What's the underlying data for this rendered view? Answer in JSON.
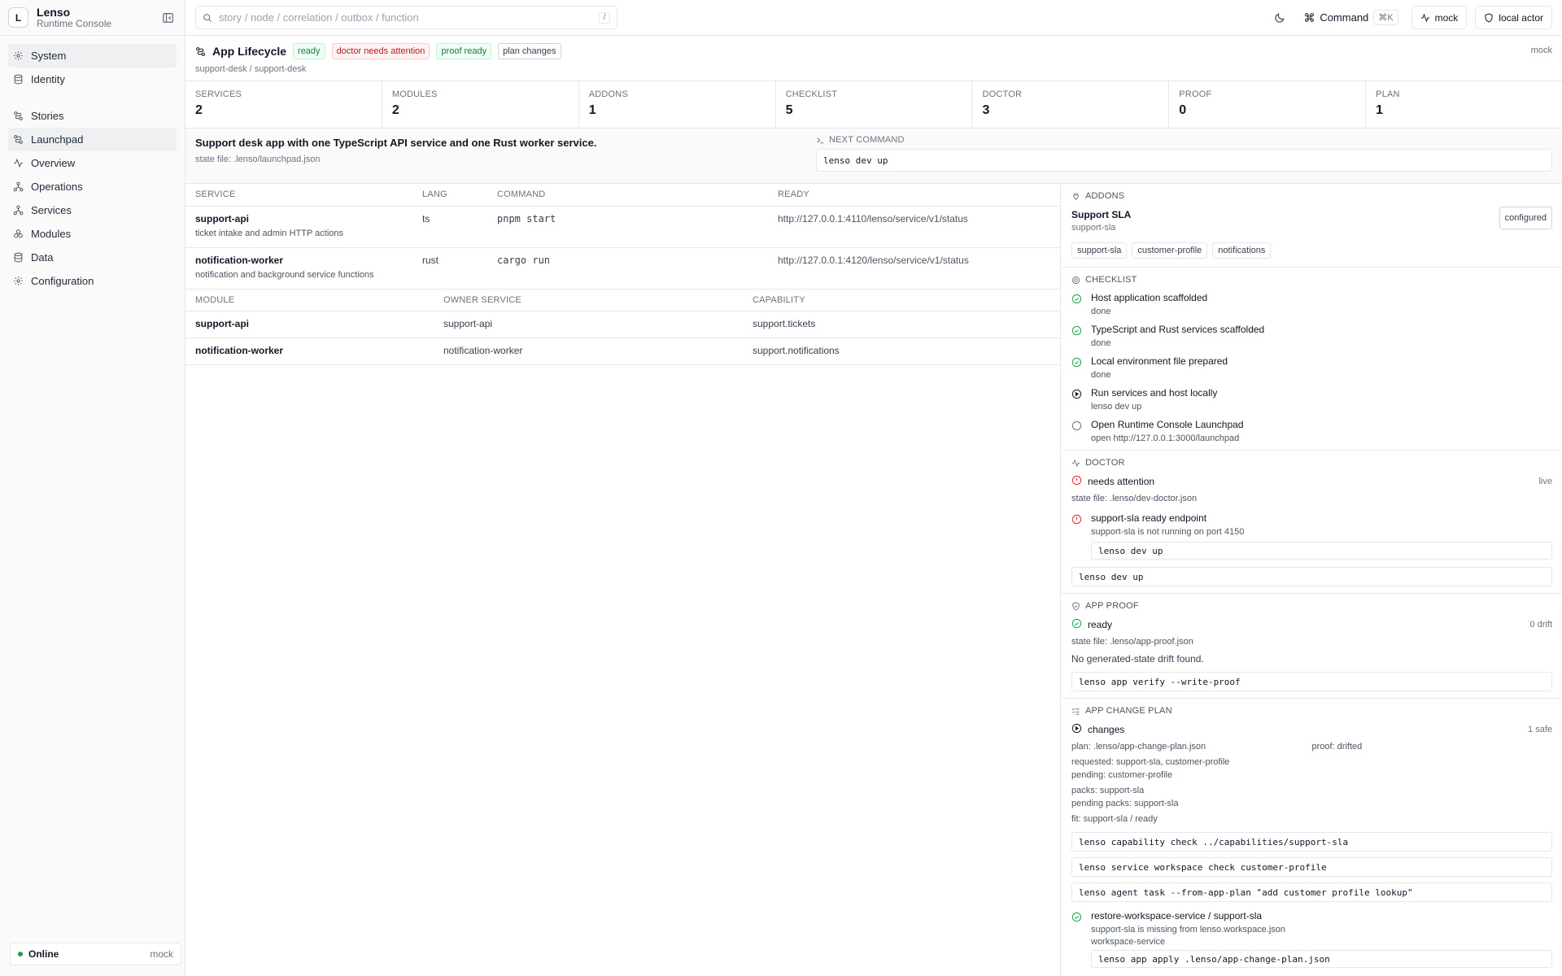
{
  "brand": {
    "name": "Lenso",
    "subtitle": "Runtime Console",
    "logo_letter": "L"
  },
  "nav": {
    "group1": [
      {
        "label": "System",
        "icon": "gear-icon",
        "active": true
      },
      {
        "label": "Identity",
        "icon": "database-icon"
      }
    ],
    "group2": [
      {
        "label": "Stories",
        "icon": "route-icon"
      },
      {
        "label": "Launchpad",
        "icon": "route-icon",
        "active": true
      },
      {
        "label": "Overview",
        "icon": "activity-icon"
      },
      {
        "label": "Operations",
        "icon": "nodes-icon"
      },
      {
        "label": "Services",
        "icon": "nodes-icon"
      },
      {
        "label": "Modules",
        "icon": "modules-icon"
      },
      {
        "label": "Data",
        "icon": "database-icon"
      },
      {
        "label": "Configuration",
        "icon": "gear-icon"
      }
    ]
  },
  "sidebar_footer": {
    "status": "Online",
    "mode": "mock"
  },
  "search": {
    "placeholder": "story / node / correlation / outbox / function",
    "shortcut": "/"
  },
  "topbar": {
    "command_label": "Command",
    "command_shortcut": "⌘K",
    "mode_label": "mock",
    "actor_label": "local actor"
  },
  "app": {
    "title": "App Lifecycle",
    "badges": [
      {
        "label": "ready",
        "tone": "green"
      },
      {
        "label": "doctor needs attention",
        "tone": "red"
      },
      {
        "label": "proof ready",
        "tone": "green"
      },
      {
        "label": "plan changes",
        "tone": "gray"
      }
    ],
    "path": "support-desk / support-desk",
    "mode": "mock"
  },
  "stats": [
    {
      "label": "SERVICES",
      "value": "2"
    },
    {
      "label": "MODULES",
      "value": "2"
    },
    {
      "label": "ADDONS",
      "value": "1"
    },
    {
      "label": "CHECKLIST",
      "value": "5"
    },
    {
      "label": "DOCTOR",
      "value": "3"
    },
    {
      "label": "PROOF",
      "value": "0"
    },
    {
      "label": "PLAN",
      "value": "1"
    }
  ],
  "summary": {
    "description": "Support desk app with one TypeScript API service and one Rust worker service.",
    "state_file": "state file: .lenso/launchpad.json",
    "next_label": "NEXT COMMAND",
    "next_command": "lenso dev up"
  },
  "services_table": {
    "headers": [
      "SERVICE",
      "LANG",
      "COMMAND",
      "READY"
    ],
    "rows": [
      {
        "name": "support-api",
        "desc": "ticket intake and admin HTTP actions",
        "lang": "ts",
        "command": "pnpm start",
        "ready": "http://127.0.0.1:4110/lenso/service/v1/status"
      },
      {
        "name": "notification-worker",
        "desc": "notification and background service functions",
        "lang": "rust",
        "command": "cargo run",
        "ready": "http://127.0.0.1:4120/lenso/service/v1/status"
      }
    ]
  },
  "modules_table": {
    "headers": [
      "MODULE",
      "OWNER SERVICE",
      "CAPABILITY"
    ],
    "rows": [
      {
        "name": "support-api",
        "owner": "support-api",
        "capability": "support.tickets"
      },
      {
        "name": "notification-worker",
        "owner": "notification-worker",
        "capability": "support.notifications"
      }
    ]
  },
  "addons": {
    "heading": "ADDONS",
    "name": "Support SLA",
    "id": "support-sla",
    "status": "configured",
    "tags": [
      "support-sla",
      "customer-profile",
      "notifications"
    ]
  },
  "checklist": {
    "heading": "CHECKLIST",
    "items": [
      {
        "title": "Host application scaffolded",
        "sub": "done",
        "state": "done"
      },
      {
        "title": "TypeScript and Rust services scaffolded",
        "sub": "done",
        "state": "done"
      },
      {
        "title": "Local environment file prepared",
        "sub": "done",
        "state": "done"
      },
      {
        "title": "Run services and host locally",
        "sub": "lenso dev up",
        "state": "next"
      },
      {
        "title": "Open Runtime Console Launchpad",
        "sub": "open http://127.0.0.1:3000/launchpad",
        "state": "todo"
      }
    ]
  },
  "doctor": {
    "heading": "DOCTOR",
    "status": "needs attention",
    "status_right": "live",
    "state_file": "state file: .lenso/dev-doctor.json",
    "issue_title": "support-sla ready endpoint",
    "issue_sub": "support-sla is not running on port 4150",
    "issue_command": "lenso dev up",
    "command": "lenso dev up"
  },
  "proof": {
    "heading": "APP PROOF",
    "status": "ready",
    "status_right": "0 drift",
    "state_file": "state file: .lenso/app-proof.json",
    "message": "No generated-state drift found.",
    "command": "lenso app verify --write-proof"
  },
  "plan": {
    "heading": "APP CHANGE PLAN",
    "status": "changes",
    "status_right": "1 safe",
    "plan_file": "plan: .lenso/app-change-plan.json",
    "proof": "proof: drifted",
    "requested": "requested: support-sla, customer-profile",
    "pending": "pending: customer-profile",
    "packs": "packs: support-sla",
    "pending_packs": "pending packs: support-sla",
    "fit": "fit: support-sla / ready",
    "commands": [
      "lenso capability check ../capabilities/support-sla",
      "lenso service workspace check customer-profile",
      "lenso agent task --from-app-plan \"add customer profile lookup\""
    ],
    "step_title": "restore-workspace-service / support-sla",
    "step_sub1": "support-sla is missing from lenso.workspace.json",
    "step_sub2": "workspace-service",
    "step_command": "lenso app apply .lenso/app-change-plan.json"
  },
  "colors": {
    "green": "#16a34a",
    "red": "#dc2626",
    "border": "#e5e7eb",
    "muted": "#6b7280"
  }
}
